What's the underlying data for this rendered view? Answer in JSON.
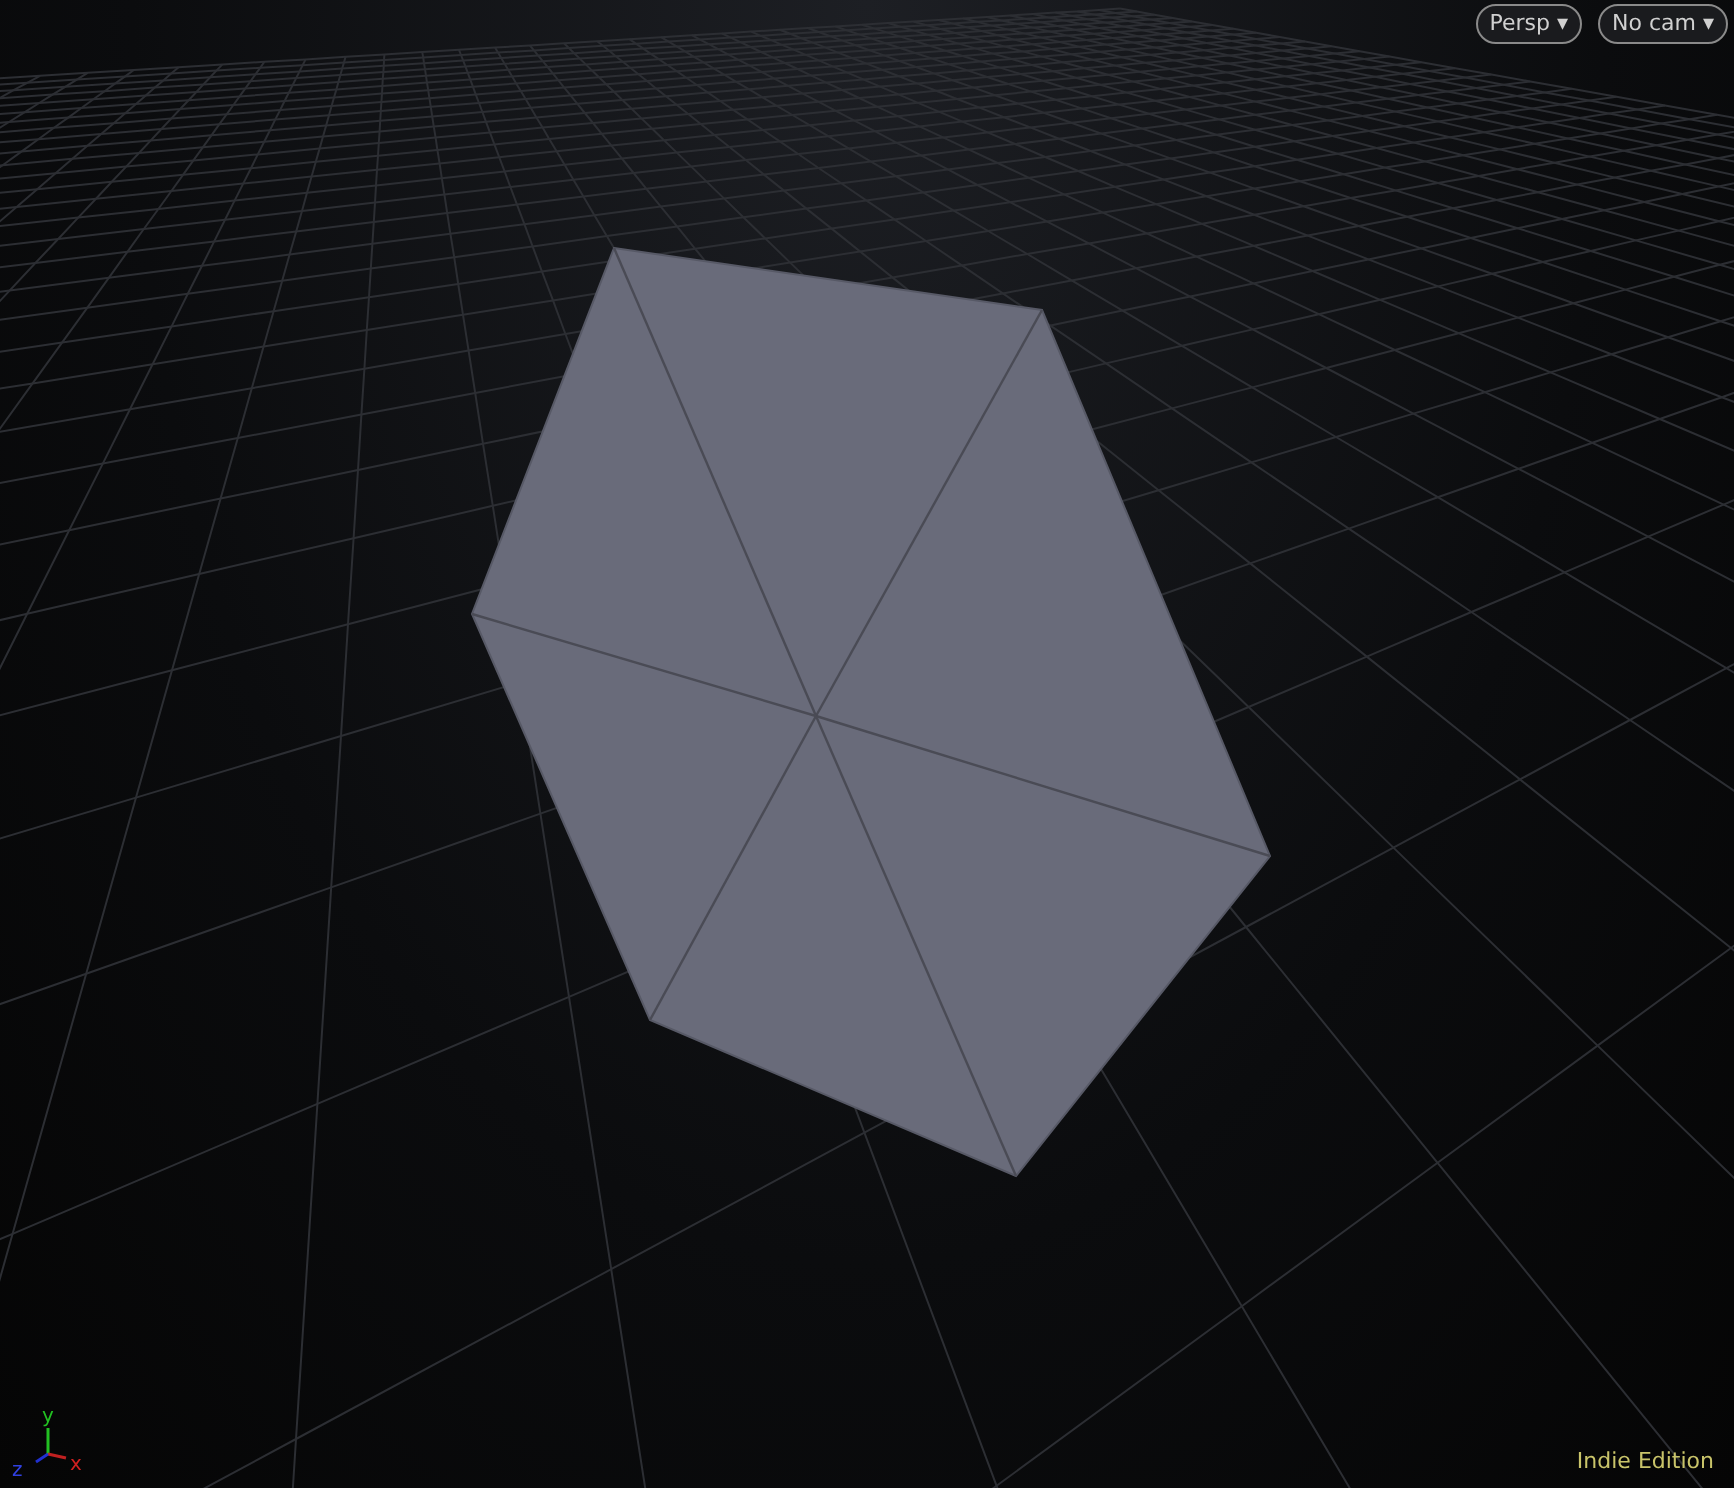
{
  "viewport_menus": [
    {
      "label": "Persp",
      "caret": "▾"
    },
    {
      "label": "No cam",
      "caret": "▾"
    }
  ],
  "axis_gizmo": {
    "x": "x",
    "y": "y",
    "z": "z"
  },
  "edition_label": "Indie Edition"
}
